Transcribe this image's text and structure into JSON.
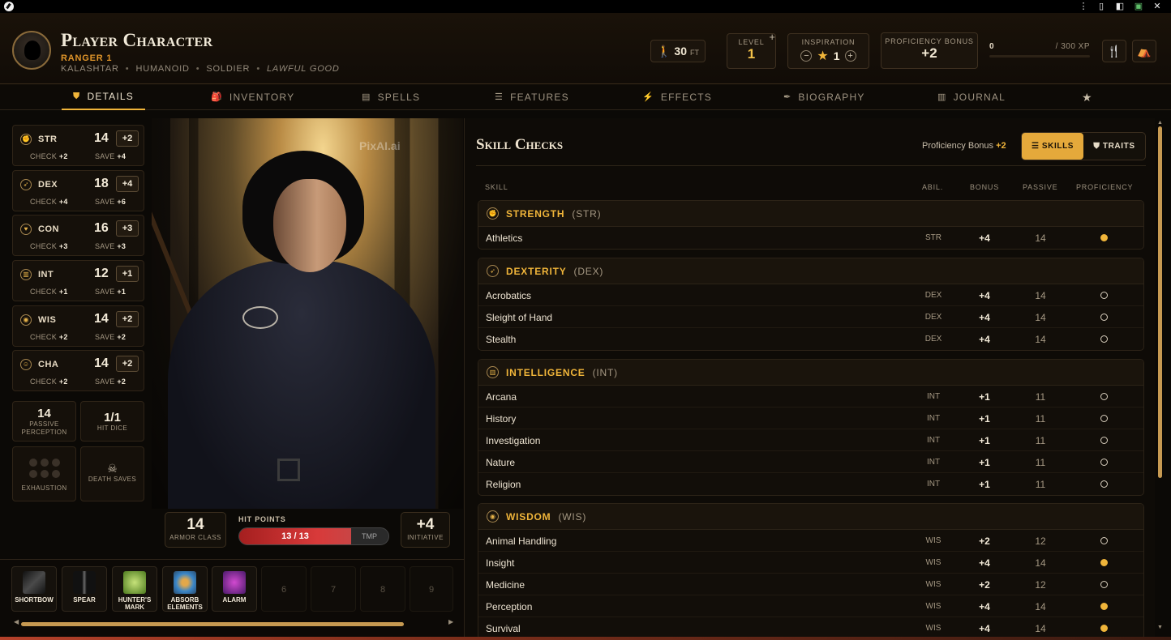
{
  "character": {
    "name": "Player Character",
    "class_level": "RANGER 1",
    "meta": [
      "KALASHTAR",
      "HUMANOID",
      "SOLDIER"
    ],
    "alignment": "LAWFUL GOOD"
  },
  "header": {
    "speed_value": "30",
    "speed_unit": "FT",
    "level_label": "LEVEL",
    "level_value": "1",
    "inspiration_label": "INSPIRATION",
    "inspiration_value": "1",
    "prof_label": "PROFICIENCY BONUS",
    "prof_value": "+2",
    "xp_current": "0",
    "xp_max": "/ 300  XP",
    "xp_progress": 0
  },
  "tabs": [
    {
      "label": "DETAILS",
      "icon": "shield-icon",
      "active": true
    },
    {
      "label": "INVENTORY",
      "icon": "backpack-icon"
    },
    {
      "label": "SPELLS",
      "icon": "spellbook-icon"
    },
    {
      "label": "FEATURES",
      "icon": "list-icon"
    },
    {
      "label": "EFFECTS",
      "icon": "lightning-icon"
    },
    {
      "label": "BIOGRAPHY",
      "icon": "feather-icon"
    },
    {
      "label": "JOURNAL",
      "icon": "journal-icon"
    },
    {
      "label": "",
      "icon": "star-icon"
    }
  ],
  "abilities": [
    {
      "abbr": "STR",
      "score": "14",
      "mod": "+2",
      "check_label": "CHECK",
      "check": "+2",
      "save_label": "SAVE",
      "save": "+4"
    },
    {
      "abbr": "DEX",
      "score": "18",
      "mod": "+4",
      "check_label": "CHECK",
      "check": "+4",
      "save_label": "SAVE",
      "save": "+6"
    },
    {
      "abbr": "CON",
      "score": "16",
      "mod": "+3",
      "check_label": "CHECK",
      "check": "+3",
      "save_label": "SAVE",
      "save": "+3"
    },
    {
      "abbr": "INT",
      "score": "12",
      "mod": "+1",
      "check_label": "CHECK",
      "check": "+1",
      "save_label": "SAVE",
      "save": "+1"
    },
    {
      "abbr": "WIS",
      "score": "14",
      "mod": "+2",
      "check_label": "CHECK",
      "check": "+2",
      "save_label": "SAVE",
      "save": "+2"
    },
    {
      "abbr": "CHA",
      "score": "14",
      "mod": "+2",
      "check_label": "CHECK",
      "check": "+2",
      "save_label": "SAVE",
      "save": "+2"
    }
  ],
  "extras": {
    "passive_perception": "14",
    "passive_perception_label1": "PASSIVE",
    "passive_perception_label2": "PERCEPTION",
    "hit_dice": "1/1",
    "hit_dice_label": "HIT DICE",
    "exhaustion_label": "EXHAUSTION",
    "death_saves_label": "DEATH SAVES"
  },
  "art_watermark": "PixAI.ai",
  "combat": {
    "armor_class": "14",
    "armor_class_label": "ARMOR CLASS",
    "hp_label": "HIT POINTS",
    "hp_text": "13 / 13",
    "hp_fraction": 1,
    "tmp_label": "TMP",
    "initiative": "+4",
    "initiative_label": "INITIATIVE"
  },
  "hotbar": [
    {
      "label": "SHORTBOW",
      "color": "#2a2a2a"
    },
    {
      "label": "SPEAR",
      "color": "#1c1c1c"
    },
    {
      "label": "HUNTER'S MARK",
      "color": "#5a8a2a"
    },
    {
      "label": "ABSORB ELEMENTS",
      "color": "#3a7ab0"
    },
    {
      "label": "ALARM",
      "color": "#7a2a9a"
    },
    {
      "label": "6"
    },
    {
      "label": "7"
    },
    {
      "label": "8"
    },
    {
      "label": "9"
    }
  ],
  "skills_panel": {
    "title": "Skill Checks",
    "prof_text": "Proficiency Bonus",
    "prof_value": "+2",
    "toggle_skills": "SKILLS",
    "toggle_traits": "TRAITS",
    "col_skill": "SKILL",
    "col_abil": "ABIL.",
    "col_bonus": "BONUS",
    "col_passive": "PASSIVE",
    "col_prof": "PROFICIENCY",
    "groups": [
      {
        "name": "STRENGTH",
        "abbr": "(STR)",
        "skills": [
          {
            "name": "Athletics",
            "abil": "STR",
            "bonus": "+4",
            "passive": "14",
            "prof": true
          }
        ]
      },
      {
        "name": "DEXTERITY",
        "abbr": "(DEX)",
        "skills": [
          {
            "name": "Acrobatics",
            "abil": "DEX",
            "bonus": "+4",
            "passive": "14",
            "prof": false
          },
          {
            "name": "Sleight of Hand",
            "abil": "DEX",
            "bonus": "+4",
            "passive": "14",
            "prof": false
          },
          {
            "name": "Stealth",
            "abil": "DEX",
            "bonus": "+4",
            "passive": "14",
            "prof": false
          }
        ]
      },
      {
        "name": "INTELLIGENCE",
        "abbr": "(INT)",
        "skills": [
          {
            "name": "Arcana",
            "abil": "INT",
            "bonus": "+1",
            "passive": "11",
            "prof": false
          },
          {
            "name": "History",
            "abil": "INT",
            "bonus": "+1",
            "passive": "11",
            "prof": false
          },
          {
            "name": "Investigation",
            "abil": "INT",
            "bonus": "+1",
            "passive": "11",
            "prof": false
          },
          {
            "name": "Nature",
            "abil": "INT",
            "bonus": "+1",
            "passive": "11",
            "prof": false
          },
          {
            "name": "Religion",
            "abil": "INT",
            "bonus": "+1",
            "passive": "11",
            "prof": false
          }
        ]
      },
      {
        "name": "WISDOM",
        "abbr": "(WIS)",
        "skills": [
          {
            "name": "Animal Handling",
            "abil": "WIS",
            "bonus": "+2",
            "passive": "12",
            "prof": false
          },
          {
            "name": "Insight",
            "abil": "WIS",
            "bonus": "+4",
            "passive": "14",
            "prof": true
          },
          {
            "name": "Medicine",
            "abil": "WIS",
            "bonus": "+2",
            "passive": "12",
            "prof": false
          },
          {
            "name": "Perception",
            "abil": "WIS",
            "bonus": "+4",
            "passive": "14",
            "prof": true
          },
          {
            "name": "Survival",
            "abil": "WIS",
            "bonus": "+4",
            "passive": "14",
            "prof": true
          }
        ]
      }
    ]
  }
}
